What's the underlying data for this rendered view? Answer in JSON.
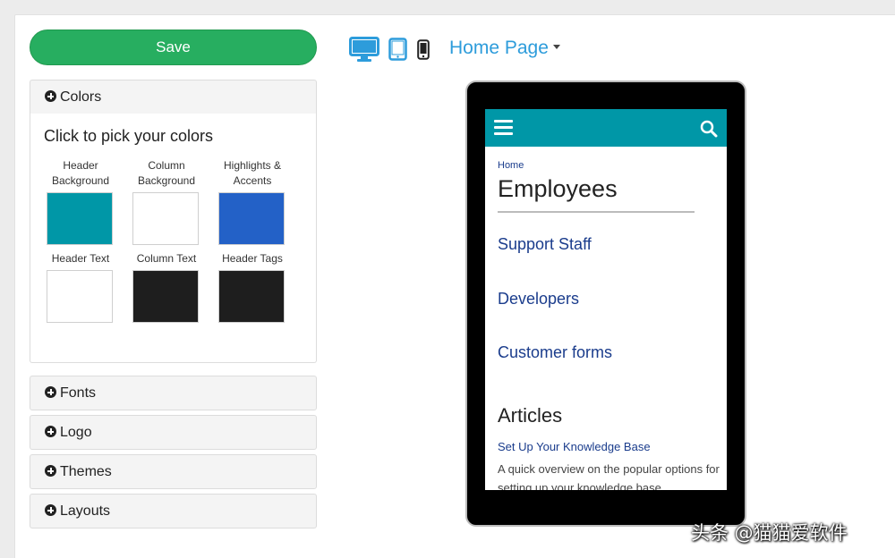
{
  "toolbar": {
    "save_label": "Save"
  },
  "accordion": {
    "colors": "Colors",
    "fonts": "Fonts",
    "logo": "Logo",
    "themes": "Themes",
    "layouts": "Layouts"
  },
  "colors_panel": {
    "title": "Click to pick your colors",
    "swatches": [
      {
        "label": "Header Background",
        "color": "#0097a7"
      },
      {
        "label": "Column Background",
        "color": "#ffffff"
      },
      {
        "label": "Highlights & Accents",
        "color": "#2361c7"
      },
      {
        "label": "Header Text",
        "color": "#ffffff"
      },
      {
        "label": "Column Text",
        "color": "#1e1e1e"
      },
      {
        "label": "Header Tags",
        "color": "#1e1e1e"
      }
    ]
  },
  "device_icons": [
    "desktop-icon",
    "tablet-icon",
    "phone-icon"
  ],
  "page_select": {
    "value": "Home Page"
  },
  "preview": {
    "breadcrumb": "Home",
    "title": "Employees",
    "categories": [
      "Support Staff",
      "Developers",
      "Customer forms"
    ],
    "articles_heading": "Articles",
    "article": {
      "title": "Set Up Your Knowledge Base",
      "description": "A quick overview on the popular options for setting up your knowledge base"
    }
  },
  "watermark": "头条 @猫猫爱软件",
  "theme_colors": {
    "accent": "#2d9cdb",
    "save": "#27ae60",
    "header": "#0097a7",
    "link": "#1a3c8c"
  }
}
